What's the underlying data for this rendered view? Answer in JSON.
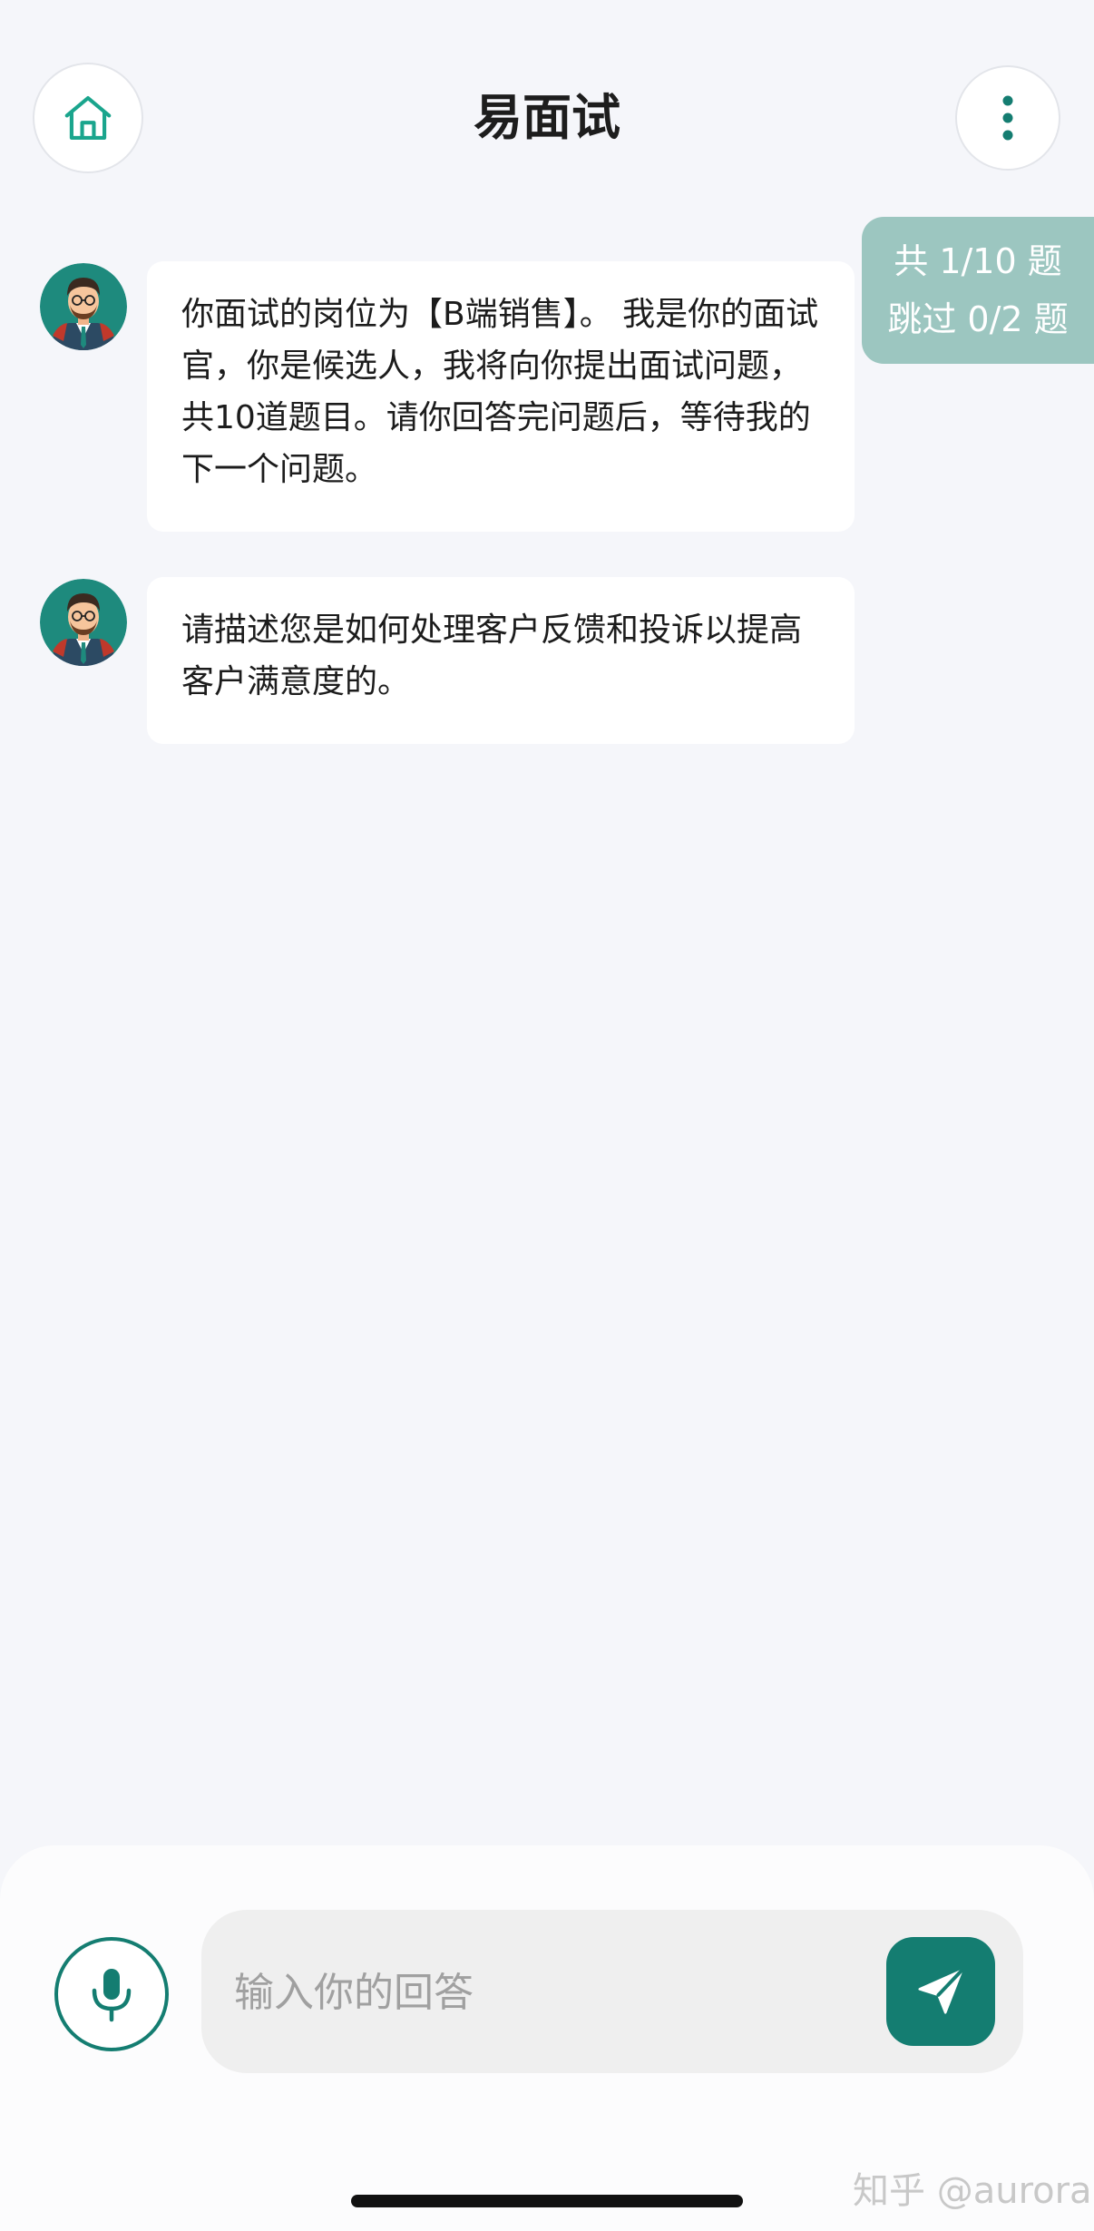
{
  "header": {
    "title": "易面试",
    "home_icon": "home-icon",
    "menu_icon": "more-vertical-icon"
  },
  "progress": {
    "total_line": "共 1/10 题",
    "skip_line": "跳过 0/2 题"
  },
  "messages": [
    {
      "sender": "interviewer",
      "avatar_icon": "interviewer-avatar",
      "text": "你面试的岗位为【B端销售】。 我是你的面试官，你是候选人，我将向你提出面试问题，共10道题目。请你回答完问题后，等待我的下一个问题。"
    },
    {
      "sender": "interviewer",
      "avatar_icon": "interviewer-avatar",
      "text": "请描述您是如何处理客户反馈和投诉以提高客户满意度的。"
    }
  ],
  "input": {
    "placeholder": "输入你的回答",
    "value": "",
    "mic_icon": "microphone-icon",
    "send_icon": "send-icon"
  },
  "watermark": "知乎 @aurora",
  "colors": {
    "accent": "#147d71",
    "badge_bg": "#9cc6c0",
    "page_bg": "#f5f6fa",
    "bubble_bg": "#ffffff"
  }
}
